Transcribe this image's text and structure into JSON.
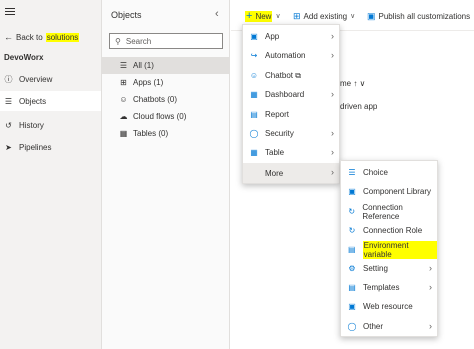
{
  "left_nav": {
    "back_prefix": "Back to ",
    "back_highlight": "solutions",
    "environment": "DevoWorx",
    "items": [
      {
        "label": "Overview",
        "icon": "info-icon"
      },
      {
        "label": "Objects",
        "icon": "list-icon",
        "selected": true
      },
      {
        "label": "History",
        "icon": "history-icon"
      },
      {
        "label": "Pipelines",
        "icon": "rocket-icon"
      }
    ]
  },
  "objects_pane": {
    "title": "Objects",
    "search_placeholder": "Search",
    "items": [
      {
        "label": "All  (1)",
        "icon": "list-icon",
        "selected": true
      },
      {
        "label": "Apps  (1)",
        "icon": "grid-icon"
      },
      {
        "label": "Chatbots  (0)",
        "icon": "chatbot-icon"
      },
      {
        "label": "Cloud flows  (0)",
        "icon": "cloud-icon"
      },
      {
        "label": "Tables  (0)",
        "icon": "table-icon"
      }
    ]
  },
  "command_bar": {
    "new": "New",
    "add_existing": "Add existing",
    "publish": "Publish all customizations"
  },
  "grid": {
    "column_header": "me ↑ ∨",
    "row_text": "driven app"
  },
  "new_menu": [
    {
      "label": "App",
      "icon": "app-icon",
      "submenu": true
    },
    {
      "label": "Automation",
      "icon": "automation-icon",
      "submenu": true
    },
    {
      "label": "Chatbot ⧉",
      "icon": "chatbot-icon",
      "submenu": false
    },
    {
      "label": "Dashboard",
      "icon": "dashboard-icon",
      "submenu": true
    },
    {
      "label": "Report",
      "icon": "report-icon",
      "submenu": false
    },
    {
      "label": "Security",
      "icon": "security-icon",
      "submenu": true
    },
    {
      "label": "Table",
      "icon": "table-icon",
      "submenu": true
    },
    {
      "label": "More",
      "icon": "",
      "submenu": true,
      "active": true
    }
  ],
  "more_menu": [
    {
      "label": "Choice",
      "icon": "choice-icon",
      "submenu": false
    },
    {
      "label": "Component Library",
      "icon": "component-library-icon",
      "submenu": false
    },
    {
      "label": "Connection Reference",
      "icon": "connection-reference-icon",
      "submenu": false
    },
    {
      "label": "Connection Role",
      "icon": "connection-role-icon",
      "submenu": false
    },
    {
      "label": "Environment variable",
      "icon": "environment-variable-icon",
      "submenu": false,
      "highlighted": true
    },
    {
      "label": "Setting",
      "icon": "setting-icon",
      "submenu": true
    },
    {
      "label": "Templates",
      "icon": "templates-icon",
      "submenu": true
    },
    {
      "label": "Web resource",
      "icon": "web-resource-icon",
      "submenu": false
    },
    {
      "label": "Other",
      "icon": "other-icon",
      "submenu": true
    }
  ],
  "colors": {
    "accent": "#0078d4",
    "highlight": "#ffff00"
  }
}
